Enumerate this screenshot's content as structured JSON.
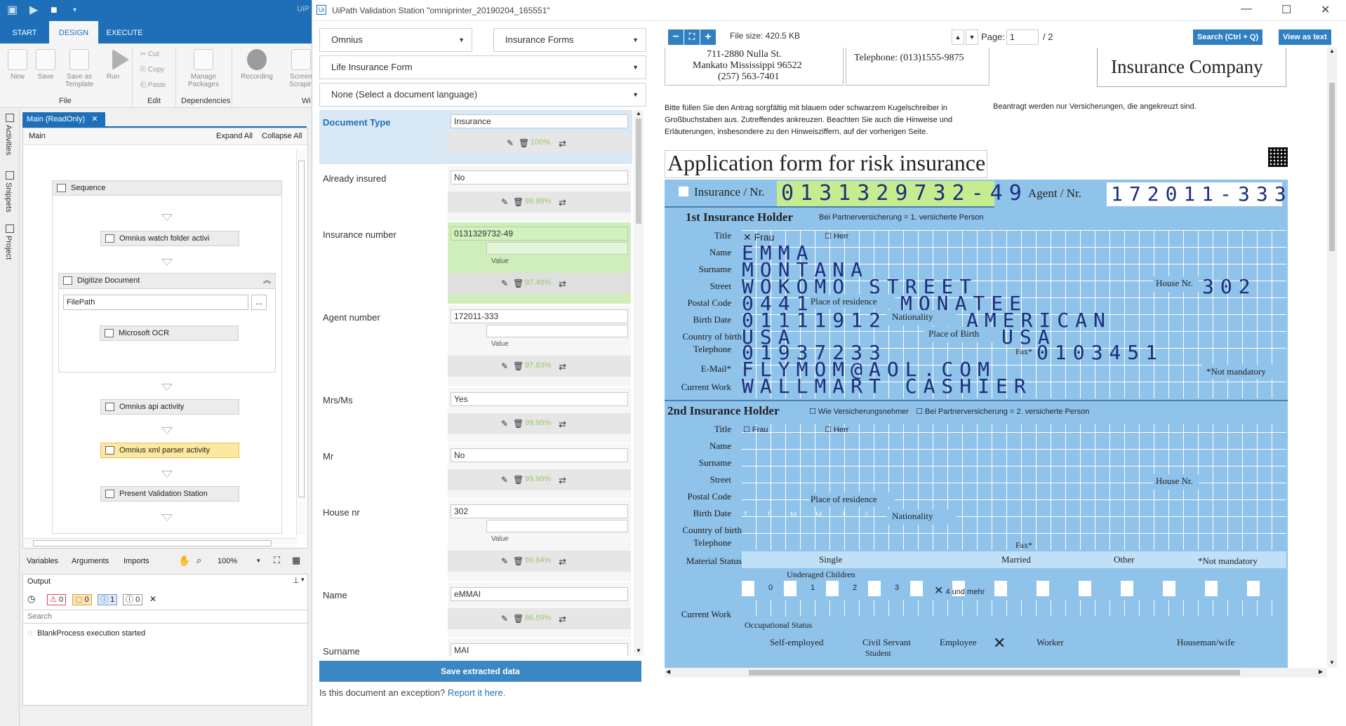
{
  "studio": {
    "title_fragment": "UiP",
    "tabs": [
      "START",
      "DESIGN",
      "EXECUTE"
    ],
    "ribbon": {
      "buttons": [
        {
          "label": "New",
          "x": 0
        },
        {
          "label": "Save",
          "x": 0
        },
        {
          "label": "Save as Template",
          "x": 0
        },
        {
          "label": "Run",
          "x": 0
        },
        {
          "label": "Manage Packages",
          "x": 0
        },
        {
          "label": "Recording",
          "x": 0
        },
        {
          "label": "Screen Scrapin",
          "x": 0
        }
      ],
      "cut": "Cut",
      "copy": "Copy",
      "paste": "Paste",
      "groups": {
        "file": "File",
        "edit": "Edit",
        "dependencies": "Dependencies",
        "wi": "Wi"
      }
    },
    "side_panels": [
      "Activities",
      "Snippets",
      "Project"
    ],
    "doc_tab": "Main (ReadOnly)",
    "designer": {
      "breadcrumb": "Main",
      "expand_all": "Expand All",
      "collapse_all": "Collapse All"
    },
    "sequence": {
      "title": "Sequence",
      "activities": [
        "Omnius watch folder activi",
        "Digitize Document",
        "Microsoft OCR",
        "Omnius api activity",
        "Omnius xml parser activity",
        "Present Validation Station"
      ],
      "filepath": "FilePath",
      "browse": "..."
    },
    "bottom_tabs": [
      "Variables",
      "Arguments",
      "Imports"
    ],
    "zoom": "100%",
    "output": {
      "title": "Output",
      "counts": {
        "error": "0",
        "warning": "0",
        "info": "1",
        "trace": "0"
      },
      "search_placeholder": "Search",
      "message": "BlankProcess execution started"
    }
  },
  "vs": {
    "title": "UiPath Validation Station \"omniprinter_20190204_165551\"",
    "dropdowns": {
      "provider": "Omnius",
      "category": "Insurance Forms",
      "form": "Life Insurance Form",
      "language": "None (Select a document language)"
    },
    "fields": [
      {
        "label": "Document Type",
        "value": "Insurance",
        "conf": "100%"
      },
      {
        "label": "Already insured",
        "value": "No",
        "conf": "99.99%"
      },
      {
        "label": "Insurance number",
        "value": "0131329732-49",
        "sub": "Value",
        "conf": "97.48%"
      },
      {
        "label": "Agent number",
        "value": "172011-333",
        "sub": "Value",
        "conf": "97.83%"
      },
      {
        "label": "Mrs/Ms",
        "value": "Yes",
        "conf": "99.99%"
      },
      {
        "label": "Mr",
        "value": "No",
        "conf": "99.99%"
      },
      {
        "label": "House nr",
        "value": "302",
        "sub": "Value",
        "conf": "99.64%"
      },
      {
        "label": "Name",
        "value": "eMMAI",
        "conf": "86.59%"
      },
      {
        "label": "Surname",
        "value": "MAI",
        "conf": ""
      }
    ],
    "save_label": "Save extracted data",
    "exception_q": "Is this document an exception?",
    "exception_link": "Report it here."
  },
  "viewer": {
    "file_size": "File size: 420.5 KB",
    "page_label": "Page:",
    "page_current": "1",
    "page_total": "/ 2",
    "search_btn": "Search (Ctrl + Q)",
    "view_text_btn": "View as text",
    "doc": {
      "addr1": "711-2880 Nulla St.",
      "addr2": "Mankato Mississippi 96522",
      "addr3": "(257) 563-7401",
      "telephone": "Telephone: (013)1555-9875",
      "company": "Insurance Company",
      "instructions": "Bitte füllen Sie den Antrag sorgfältig mit blauem oder schwarzem Kugelschreiber in Großbuchstaben aus. Zutreffendes ankreuzen. Beachten Sie auch die Hinweise und Erläuterungen, insbesondere zu den Hinweisziffern, auf der vorherigen Seite.",
      "instructions_right": "Beantragt werden nur Versicherungen, die angekreuzt sind.",
      "form_title": "Application form for risk insurance",
      "insurance_nr_label": "Insurance / Nr.",
      "insurance_nr": "0131329732-49",
      "agent_label": "Agent / Nr.",
      "agent_nr": "172011-333",
      "holder1": "1st Insurance Holder",
      "holder1_note": "Bei Partnerversicherung = 1. versicherte Person",
      "labels1": [
        "Title",
        "Name",
        "Surname",
        "Street",
        "Postal Code",
        "Birth Date",
        "Country of birth",
        "Telephone",
        "E-Mail*",
        "Current Work"
      ],
      "frau": "Frau",
      "herr": "Herr",
      "name_hw": "EMMA",
      "surname_hw": "MONTANA",
      "street_hw": "WOKOMO STREET",
      "house_label": "House Nr.",
      "house_hw": "302",
      "postal_hw": "0441",
      "place_label": "Place of residence",
      "place_hw": "MONATEE",
      "birth_hw": "01111912",
      "nationality_label": "Nationality",
      "nationality_hw": "AMERICAN",
      "country_hw": "USA",
      "place_birth_label": "Place of Birth",
      "place_birth_hw": "USA",
      "phone_hw": "01937233",
      "fax_label": "Fax*",
      "fax_hw": "0103451",
      "email_hw": "FLYMOM@AOL.COM",
      "work_hw": "WALLMART CASHIER",
      "not_mandatory": "*Not mandatory",
      "holder2": "2nd Insurance Holder",
      "holder2_note1": "Wie Versicherungsnehmer",
      "holder2_note2": "Bei Partnerversicherung = 2. versicherte Person",
      "labels2": [
        "Title",
        "Name",
        "Surname",
        "Street",
        "Postal Code",
        "Birth Date",
        "Country of birth",
        "Telephone",
        "Material Status",
        "Current Work"
      ],
      "date_ghost": "T T M M J J J J",
      "marital": [
        "Single",
        "Married",
        "Other"
      ],
      "children_label": "Underaged Children",
      "children": [
        "0",
        "1",
        "2",
        "3",
        "4 und mehr"
      ],
      "occ_label": "Occupational Status",
      "occ": [
        "Self-employed",
        "Civil Servant",
        "Employee",
        "Worker",
        "Houseman/wife"
      ],
      "occ_sub": "Student"
    }
  },
  "colors": {
    "accent": "#1e6fb8",
    "button": "#3b87c4",
    "form_blue": "#8fc3ea",
    "green": "#d3f2c0"
  }
}
